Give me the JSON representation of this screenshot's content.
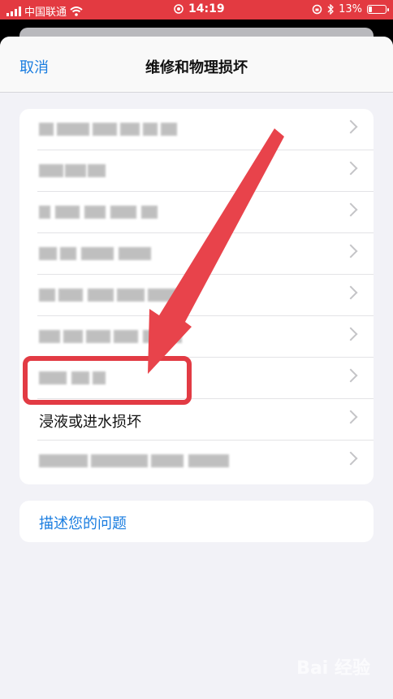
{
  "status_bar": {
    "carrier": "中国联通",
    "time": "14:19",
    "battery": "13%",
    "icons": [
      "signal-icon",
      "wifi-icon",
      "lock-rotation-icon",
      "bluetooth-icon",
      "battery-icon"
    ]
  },
  "nav": {
    "cancel_label": "取消",
    "title": "维修和物理损坏"
  },
  "list": {
    "highlighted_item_label": "浸液或进水损坏"
  },
  "describe_link": "描述您的问题",
  "watermark": "Bai 经验",
  "colors": {
    "accent": "#1a7de0",
    "highlight": "#e23b44",
    "status_bar": "#e33a41"
  }
}
